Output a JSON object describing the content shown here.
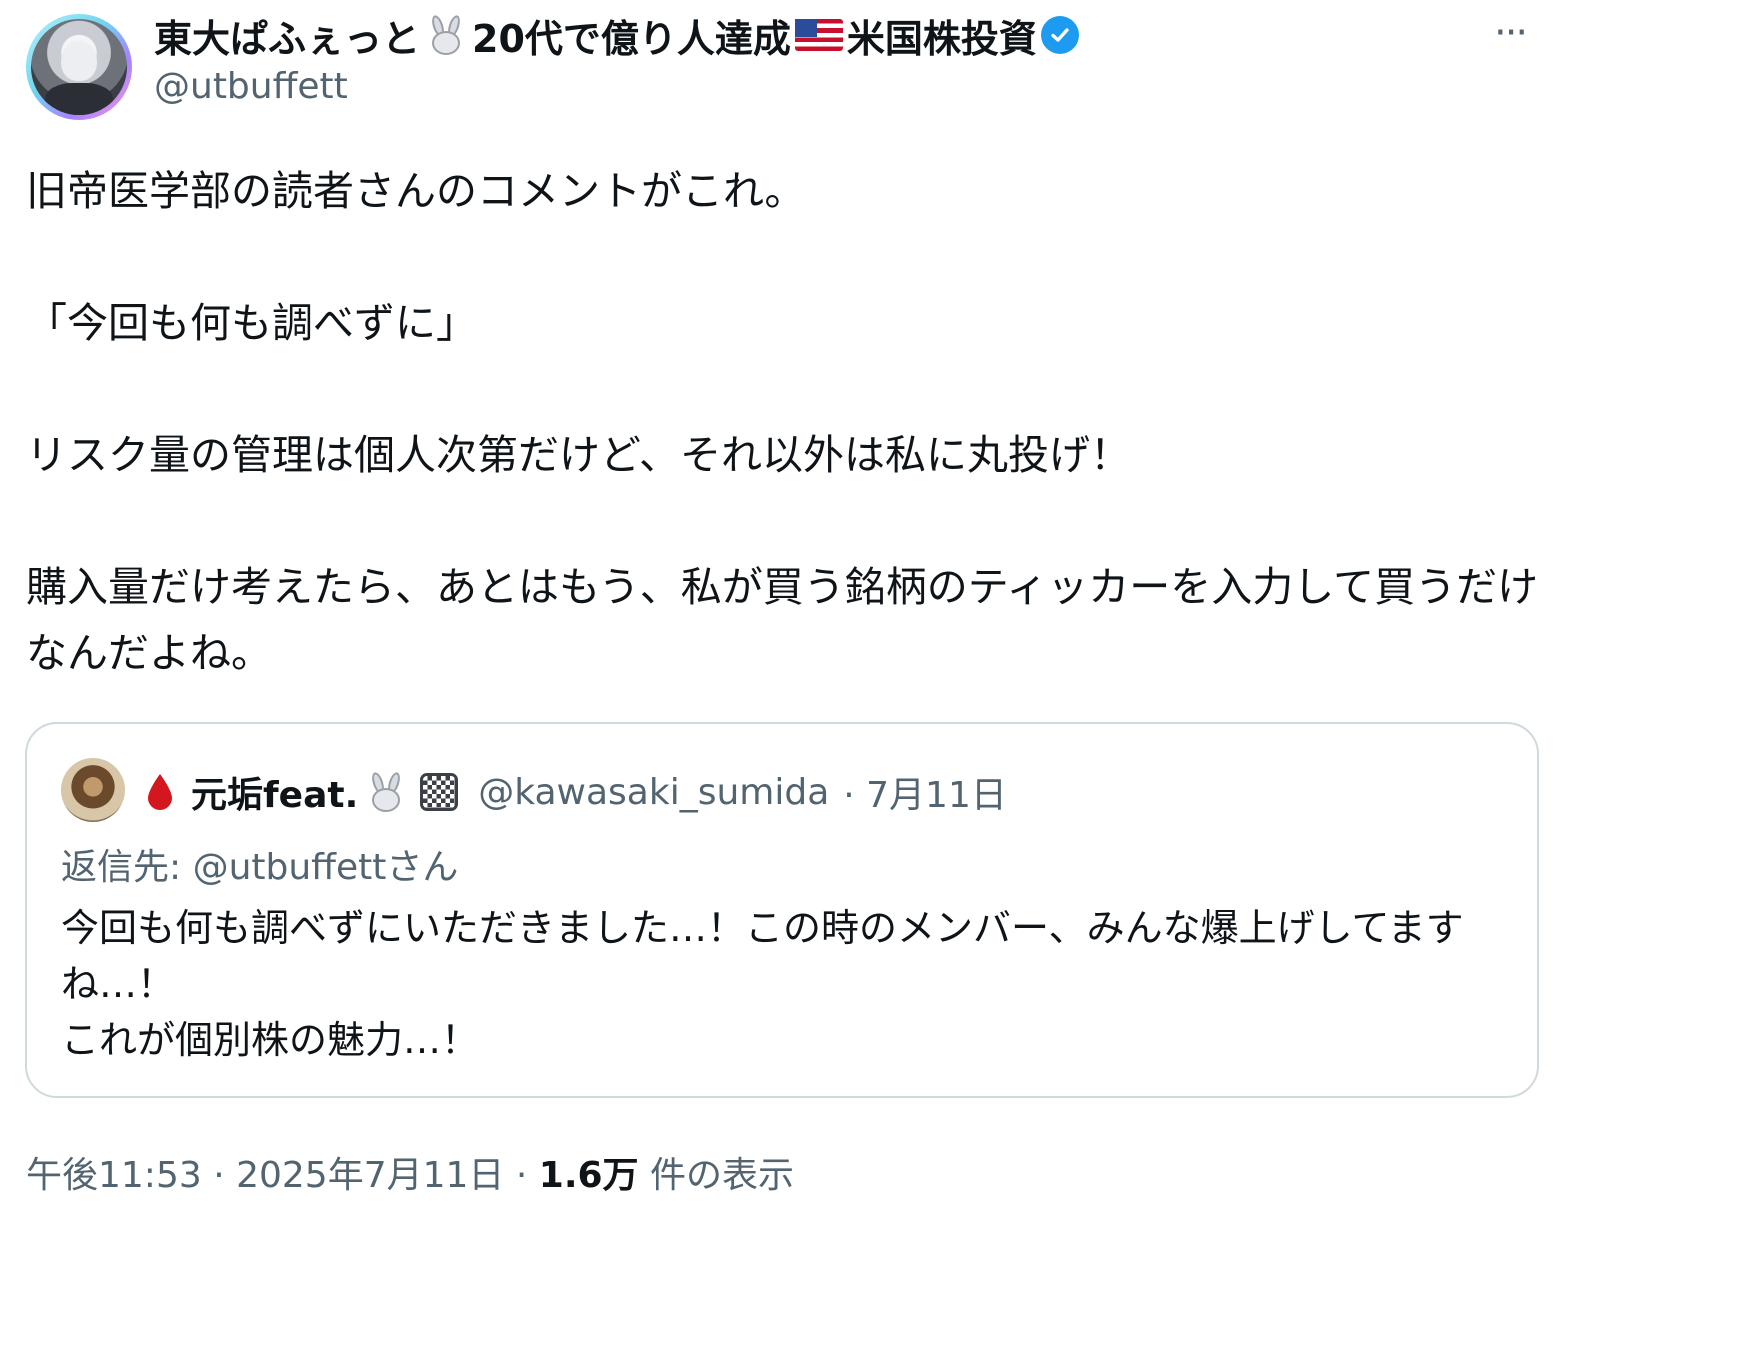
{
  "author": {
    "display_name": "東大ぱふぇっと",
    "name_middle": "20代で億り人達成",
    "name_suffix": "米国株投資",
    "handle": "@utbuffett",
    "verified": true,
    "avatar_icon": "anime-avatar-icon"
  },
  "more_button": "···",
  "post": {
    "paragraphs": [
      "旧帝医学部の読者さんのコメントがこれ。",
      "「今回も何も調べずに」",
      "リスク量の管理は個人次第だけど、それ以外は私に丸投げ！",
      "購入量だけ考えたら、あとはもう、私が買う銘柄のティッカーを入力して買うだけなんだよね。"
    ]
  },
  "quote": {
    "display_name": "元垢feat.",
    "handle": "@kawasaki_sumida",
    "date": "· 7月11日",
    "reply_to": "返信先: @utbuffettさん",
    "lines": [
      "今回も何も調べずにいただきました…！この時のメンバー、みんな爆上げしてますね…！",
      "これが個別株の魅力…！"
    ]
  },
  "footer": {
    "time": "午後11:53",
    "sep1": " · ",
    "date": "2025年7月11日",
    "sep2": " · ",
    "views_count": "1.6万",
    "views_label": " 件の表示"
  },
  "colors": {
    "text": "#0f1419",
    "secondary": "#536471",
    "verified": "#1d9bf0",
    "border": "#cfd9de"
  }
}
